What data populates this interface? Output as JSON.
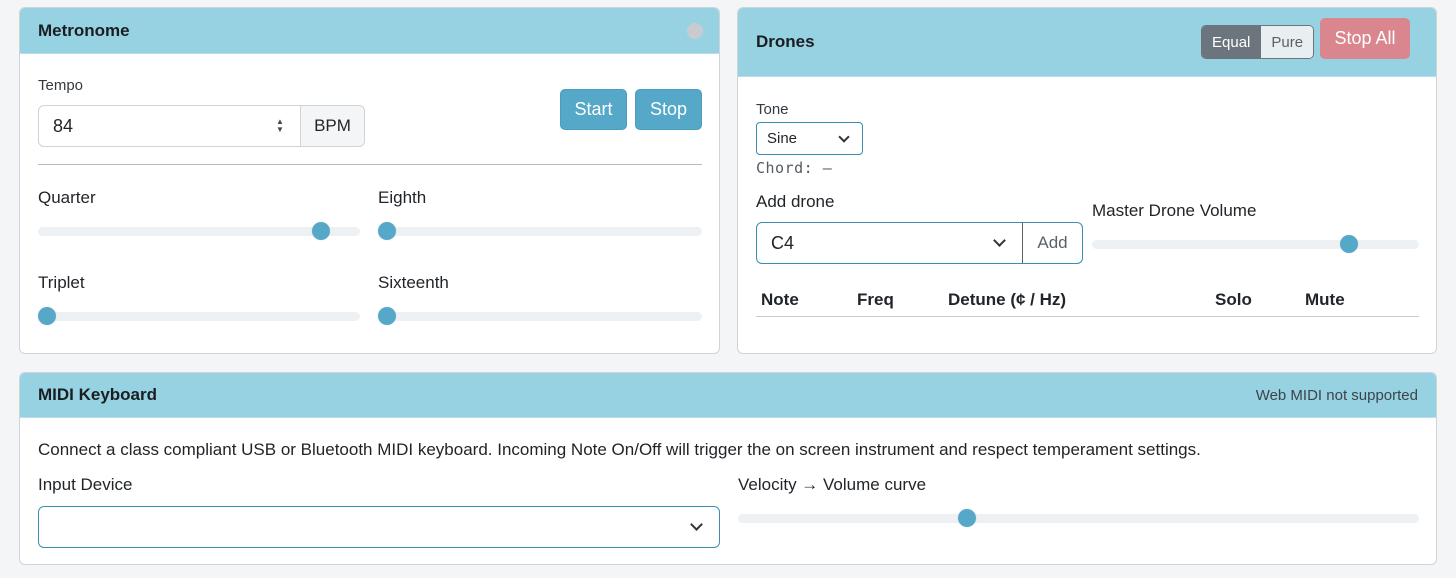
{
  "metronome": {
    "title": "Metronome",
    "tempo_label": "Tempo",
    "tempo_value": "84",
    "tempo_unit": "BPM",
    "start_label": "Start",
    "stop_label": "Stop",
    "sliders": [
      {
        "label": "Quarter",
        "level": 0.88
      },
      {
        "label": "Eighth",
        "level": 0.0
      },
      {
        "label": "Triplet",
        "level": 0.0
      },
      {
        "label": "Sixteenth",
        "level": 0.0
      }
    ]
  },
  "drones": {
    "title": "Drones",
    "temperament_options": [
      "Equal",
      "Pure"
    ],
    "temperament_selected": "Equal",
    "stop_all_label": "Stop All",
    "tone_label": "Tone",
    "tone_value": "Sine",
    "chord_text": "Chord: —",
    "add_drone_label": "Add drone",
    "add_drone_value": "C4",
    "add_button_label": "Add",
    "master_volume_label": "Master Drone Volume",
    "master_volume_level": 0.78,
    "table_headers": [
      "Note",
      "Freq",
      "Detune (¢ / Hz)",
      "Solo",
      "Mute"
    ]
  },
  "midi": {
    "title": "MIDI Keyboard",
    "status": "Web MIDI not supported",
    "description": "Connect a class compliant USB or Bluetooth MIDI keyboard. Incoming Note On/Off will trigger the on screen instrument and respect temperament settings.",
    "input_device_label": "Input Device",
    "input_device_value": "",
    "velocity_label": "Velocity → Volume curve",
    "velocity_level": 0.34
  },
  "colors": {
    "header_bg": "#97d2e3",
    "accent": "#56a8c9",
    "danger_muted": "#d9868e",
    "toggle_active": "#6c757d"
  }
}
